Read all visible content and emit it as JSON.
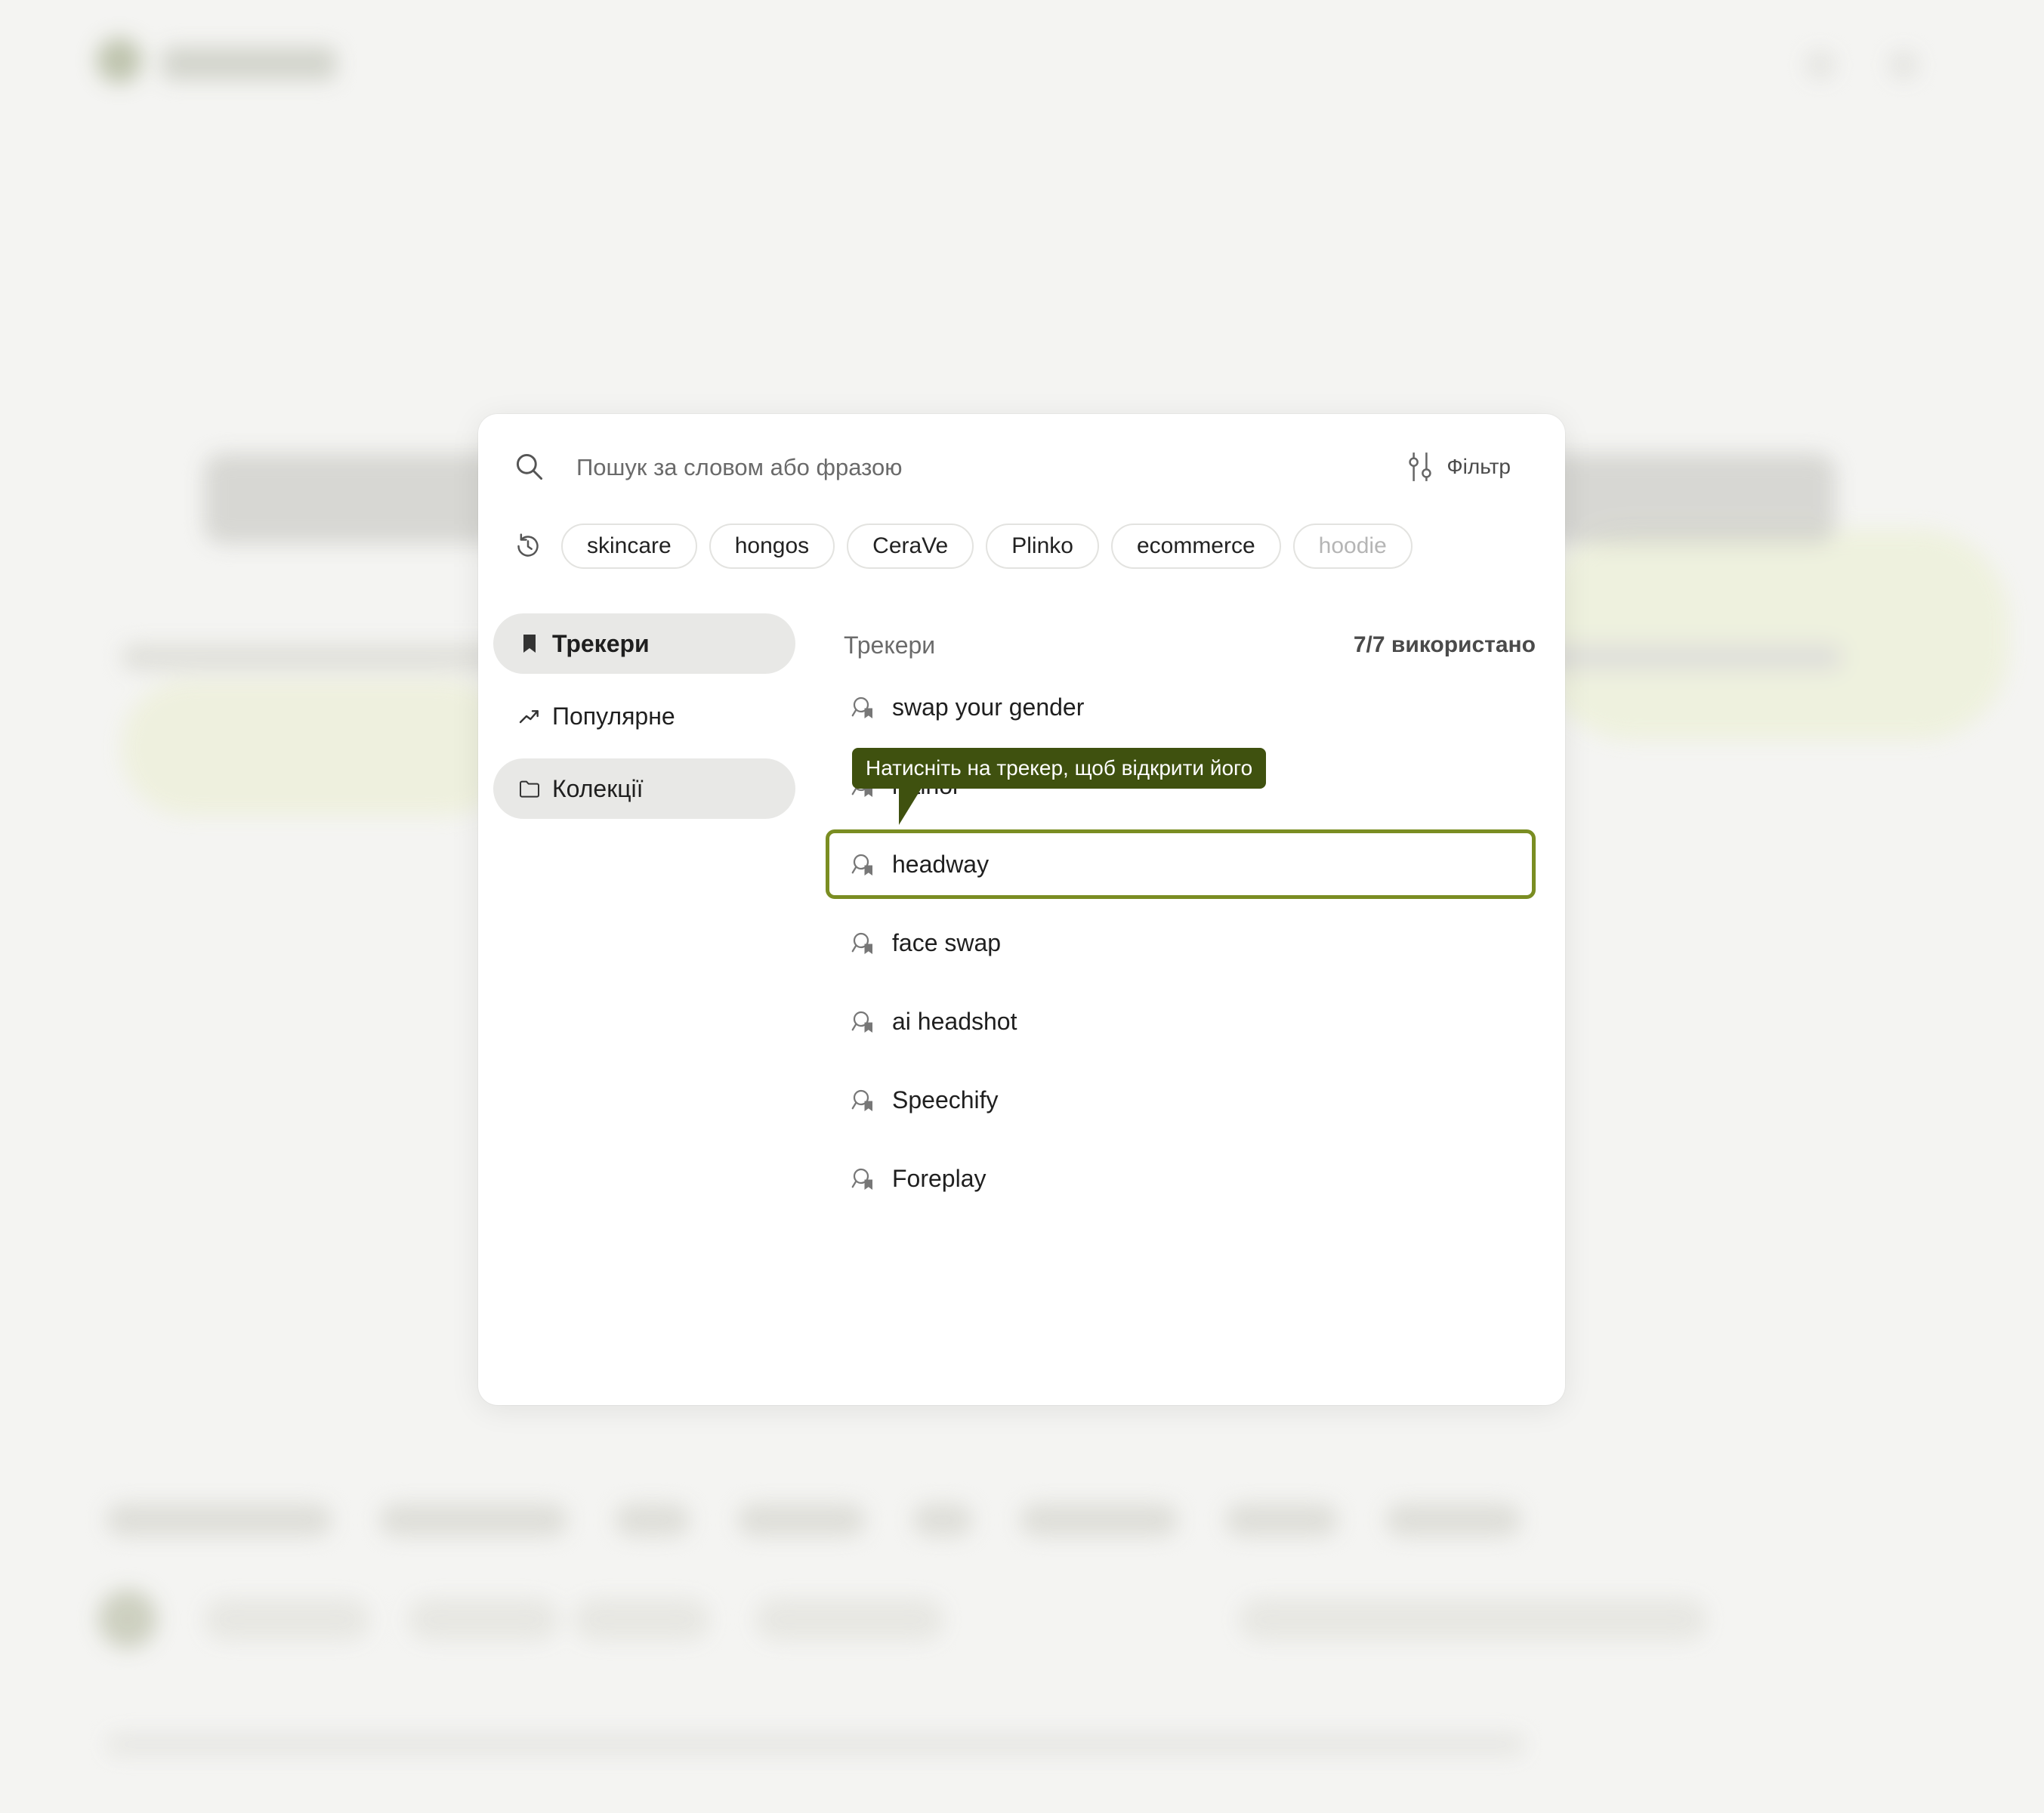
{
  "search": {
    "placeholder": "Пошук за словом або фразою",
    "filter_label": "Фільтр"
  },
  "recent_searches": [
    "skincare",
    "hongos",
    "CeraVe",
    "Plinko",
    "ecommerce",
    "hoodie"
  ],
  "nav": {
    "items": [
      {
        "label": "Трекери",
        "icon": "bookmark-icon",
        "state": "active"
      },
      {
        "label": "Популярне",
        "icon": "trending-up-icon",
        "state": "default"
      },
      {
        "label": "Колекції",
        "icon": "folder-icon",
        "state": "hover"
      }
    ]
  },
  "trackers": {
    "title": "Трекери",
    "usage": "7/7 використано",
    "items": [
      {
        "label": "swap your gender"
      },
      {
        "label": "retinol"
      },
      {
        "label": "headway"
      },
      {
        "label": "face swap"
      },
      {
        "label": "ai headshot"
      },
      {
        "label": "Speechify"
      },
      {
        "label": "Foreplay"
      }
    ]
  },
  "tooltip": {
    "text": "Натисніть на трекер, щоб відкрити його"
  },
  "colors": {
    "accent": "#7a8d22",
    "tooltip_bg": "#3f510f",
    "nav_active_bg": "#e8e8e6"
  }
}
